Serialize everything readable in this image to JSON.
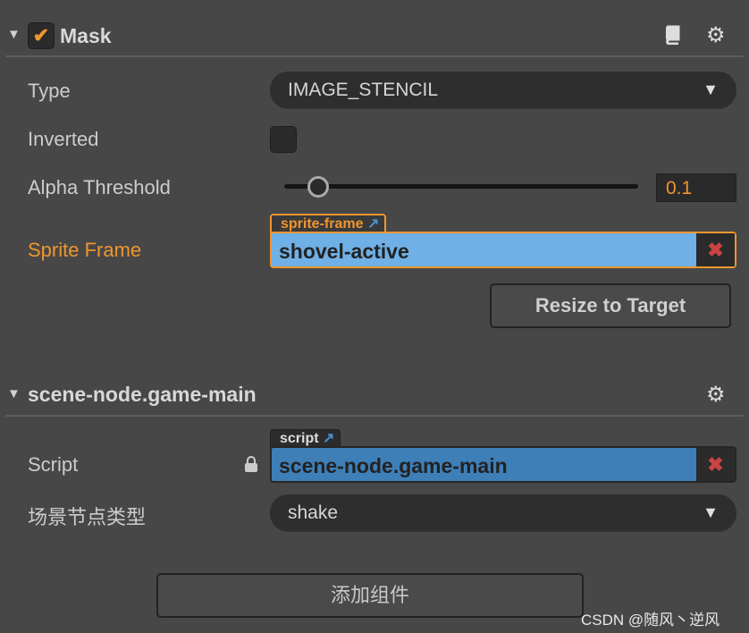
{
  "mask": {
    "title": "Mask",
    "enabled": true,
    "type": {
      "label": "Type",
      "value": "IMAGE_STENCIL"
    },
    "inverted": {
      "label": "Inverted",
      "checked": false
    },
    "alpha": {
      "label": "Alpha Threshold",
      "value": "0.1",
      "fraction": 0.1
    },
    "sprite": {
      "label": "Sprite Frame",
      "tag": "sprite-frame",
      "value": "shovel-active"
    },
    "resize_label": "Resize to Target"
  },
  "script_comp": {
    "title": "scene-node.game-main",
    "script": {
      "label": "Script",
      "tag": "script",
      "value": "scene-node.game-main"
    },
    "scene_type": {
      "label": "场景节点类型",
      "value": "shake"
    }
  },
  "add_component": "添加组件",
  "watermark": "CSDN @随风丶逆风",
  "colors": {
    "accent": "#f0962e",
    "sprite_field": "#6fb0e6",
    "script_field": "#3e7fb8",
    "remove": "#c94444"
  }
}
